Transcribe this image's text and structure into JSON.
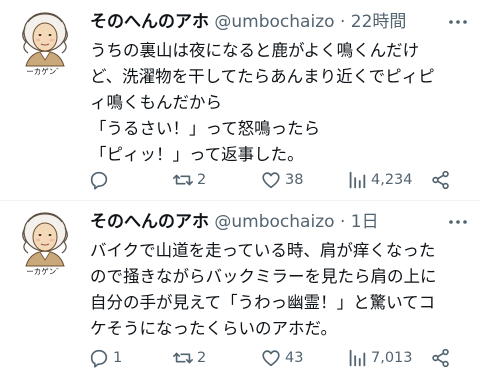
{
  "colors": {
    "text": "#0f1419",
    "secondary": "#536471",
    "divider": "#eff3f4"
  },
  "tweets": [
    {
      "author_name": "そのへんのアホ",
      "handle": "@umbochaizo",
      "separator": "·",
      "time": "22時間",
      "avatar_caption": "ーカゲン゛",
      "lines": [
        "うちの裏山は夜になると鹿がよく鳴くんだけ",
        "ど、洗濯物を干してたらあんまり近くでピィピ",
        "ィ鳴くもんだから",
        "「うるさい！」って怒鳴ったら",
        "「ピィッ！」って返事した。"
      ],
      "stats": {
        "replies": "",
        "retweets": "2",
        "likes": "38",
        "views": "4,234"
      },
      "icons": [
        "reply-icon",
        "retweet-icon",
        "heart-icon",
        "views-icon",
        "share-icon",
        "more-icon"
      ]
    },
    {
      "author_name": "そのへんのアホ",
      "handle": "@umbochaizo",
      "separator": "·",
      "time": "1日",
      "avatar_caption": "ーカゲン゛",
      "lines": [
        "バイクで山道を走っている時、肩が痒くなった",
        "ので掻きながらバックミラーを見たら肩の上に",
        "自分の手が見えて「うわっ幽霊！」と驚いてコ",
        "ケそうになったくらいのアホだ。"
      ],
      "stats": {
        "replies": "1",
        "retweets": "2",
        "likes": "43",
        "views": "7,013"
      },
      "icons": [
        "reply-icon",
        "retweet-icon",
        "heart-icon",
        "views-icon",
        "share-icon",
        "more-icon"
      ]
    }
  ]
}
